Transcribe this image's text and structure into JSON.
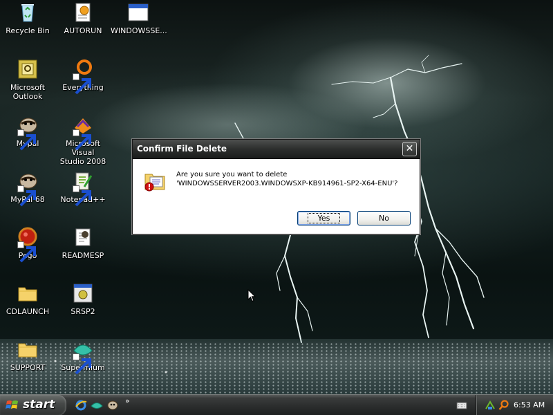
{
  "desktop": {
    "icons": [
      {
        "label": "Recycle Bin",
        "icon": "recycle-bin-icon",
        "shortcut": false
      },
      {
        "label": "AUTORUN",
        "icon": "autorun-icon",
        "shortcut": false
      },
      {
        "label": "WINDOWSSE...",
        "icon": "window-app-icon",
        "shortcut": false
      },
      {
        "label": "Microsoft\nOutlook",
        "icon": "outlook-icon",
        "shortcut": false
      },
      {
        "label": "Everything",
        "icon": "everything-icon",
        "shortcut": true
      },
      {
        "label": "Mypal",
        "icon": "mypal-icon",
        "shortcut": true
      },
      {
        "label": "Microsoft Visual\nStudio 2008",
        "icon": "visual-studio-icon",
        "shortcut": true
      },
      {
        "label": "MyPal 68",
        "icon": "mypal68-icon",
        "shortcut": true
      },
      {
        "label": "Notepad++",
        "icon": "notepadpp-icon",
        "shortcut": true
      },
      {
        "label": "Pego",
        "icon": "pego-icon",
        "shortcut": true
      },
      {
        "label": "READMESP",
        "icon": "readme-icon",
        "shortcut": false
      },
      {
        "label": "CDLAUNCH",
        "icon": "folder-icon",
        "shortcut": false
      },
      {
        "label": "SRSP2",
        "icon": "srsp2-icon",
        "shortcut": false
      },
      {
        "label": "SUPPORT",
        "icon": "folder-icon",
        "shortcut": false
      },
      {
        "label": "Supermium",
        "icon": "supermium-icon",
        "shortcut": true
      }
    ]
  },
  "dialog": {
    "title": "Confirm File Delete",
    "close_label": "✕",
    "message_line1": "Are you sure you want to delete",
    "message_line2": "'WINDOWSSERVER2003.WINDOWSXP-KB914961-SP2-X64-ENU'?",
    "yes_label": "Yes",
    "no_label": "No",
    "icon": "delete-warning-icon"
  },
  "taskbar": {
    "start_label": "start",
    "quick_launch": [
      "internet-explorer-icon",
      "supermium-icon",
      "mypal-icon"
    ],
    "more_label": "»",
    "clock": "6:53 AM",
    "tray_icons": [
      "network-icon",
      "search-icon"
    ]
  },
  "colors": {
    "title_bar": "#2c2e2d",
    "dialog_body": "#ffffff",
    "button_border": "#003c74",
    "desktop_text": "#ffffff"
  }
}
